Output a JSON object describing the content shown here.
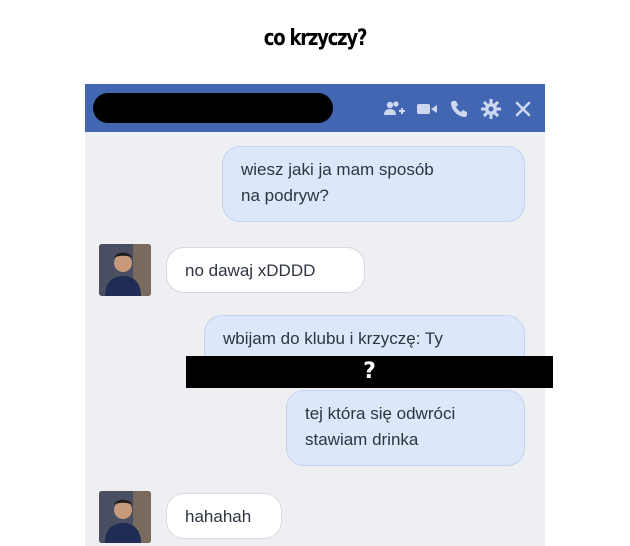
{
  "caption": "co krzyczy?",
  "redaction_text": "?",
  "title_bar": {
    "icons": [
      "add-person-icon",
      "video-camera-icon",
      "phone-icon",
      "gear-icon",
      "close-icon"
    ]
  },
  "messages": [
    {
      "direction": "out",
      "line1": "wiesz jaki ja mam sposób",
      "line2": "na podryw?"
    },
    {
      "direction": "in",
      "text": "no dawaj xDDDD"
    },
    {
      "direction": "out",
      "text": "wbijam do klubu i krzyczę: Ty"
    },
    {
      "direction": "out",
      "line1": "tej która się odwróci",
      "line2": "stawiam drinka"
    },
    {
      "direction": "in",
      "text": "hahahah"
    }
  ],
  "colors": {
    "title_bar": "#4266b2",
    "out_bubble": "#dce8fa",
    "in_bubble": "#ffffff",
    "chat_bg": "#eeeff3"
  }
}
